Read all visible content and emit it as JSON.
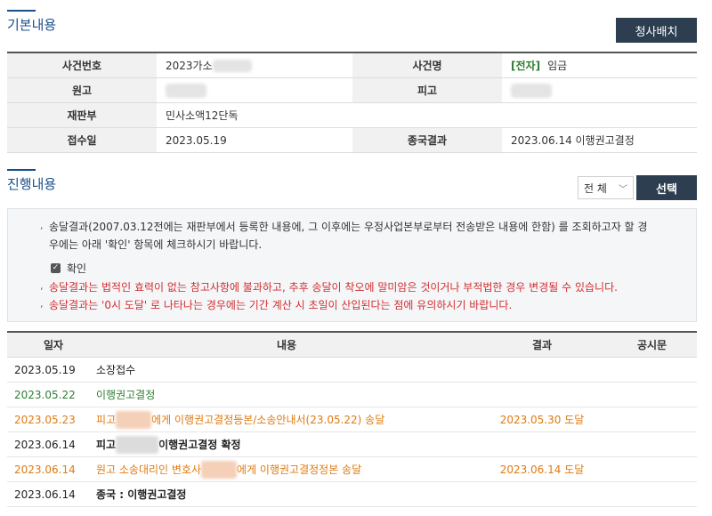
{
  "basic": {
    "title": "기본내용",
    "seating_button": "청사배치",
    "rows": [
      {
        "label1": "사건번호",
        "value1": "2023가소",
        "label2": "사건명",
        "tag2": "[전자]",
        "value2": "임금"
      },
      {
        "label1": "원고",
        "value1": "",
        "label2": "피고",
        "value2": ""
      },
      {
        "label1": "재판부",
        "value1": "민사소액12단독",
        "label2": "",
        "value2": ""
      },
      {
        "label1": "접수일",
        "value1": "2023.05.19",
        "label2": "종국결과",
        "value2": "2023.06.14 이행권고결정"
      }
    ]
  },
  "progress": {
    "title": "진행내용",
    "filter_value": "전 체",
    "select_button": "선택",
    "notice": {
      "line1": "송달결과(2007.03.12전에는 재판부에서 등록한 내용에, 그 이후에는 우정사업본부로부터 전송받은 내용에 한함) 를 조회하고자 할 경",
      "line1b": "우에는 아래 '확인' 항목에 체크하시기 바랍니다.",
      "checkbox_label": "확인",
      "line2": "송달결과는 법적인 효력이 없는 참고사항에 불과하고, 추후 송달이 착오에 말미암은 것이거나 부적법한 경우 변경될 수 있습니다.",
      "line3": "송달결과는 '0시 도달' 로 나타나는 경우에는 기간 계산 시 초일이 산입된다는 점에 유의하시기 바랍니다."
    },
    "headers": {
      "date": "일자",
      "content": "내용",
      "result": "결과",
      "notice": "공시문"
    },
    "rows": [
      {
        "date": "2023.05.19",
        "pre": "소장접수",
        "post": "",
        "result": "",
        "color": "black"
      },
      {
        "date": "2023.05.22",
        "pre": "이행권고결정",
        "post": "",
        "result": "",
        "color": "green"
      },
      {
        "date": "2023.05.23",
        "pre": "피고 ",
        "post": "에게 이행권고결정등본/소송안내서(23.05.22) 송달",
        "result": "2023.05.30 도달",
        "color": "orange"
      },
      {
        "date": "2023.06.14",
        "pre": "피고 ",
        "post": "이행권고결정 확정",
        "result": "",
        "color": "black"
      },
      {
        "date": "2023.06.14",
        "pre": "원고 소송대리인 변호사 ",
        "post": "에게 이행권고결정정본 송달",
        "result": "2023.06.14 도달",
        "color": "orange"
      },
      {
        "date": "2023.06.14",
        "pre": "종국 : 이행권고결정",
        "post": "",
        "result": "",
        "color": "black"
      }
    ]
  }
}
